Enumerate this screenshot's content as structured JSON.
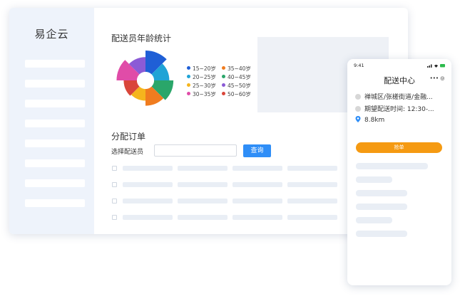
{
  "app": {
    "logo": "易企云"
  },
  "sidebar": {
    "item_count": 8
  },
  "age_chart": {
    "title": "配送员年龄统计",
    "legend": [
      {
        "label": "15~20岁",
        "color": "#1f5fd6"
      },
      {
        "label": "35~40岁",
        "color": "#f07c1f"
      },
      {
        "label": "20~25岁",
        "color": "#1fa3d6"
      },
      {
        "label": "40~45岁",
        "color": "#2aa66a"
      },
      {
        "label": "25~30岁",
        "color": "#f5b51d"
      },
      {
        "label": "45~50岁",
        "color": "#8b5bd6"
      },
      {
        "label": "30~35岁",
        "color": "#e04ca8"
      },
      {
        "label": "50~60岁",
        "color": "#d9463a"
      }
    ]
  },
  "chart_data": {
    "type": "pie",
    "variant": "nightingale-rose",
    "title": "配送员年龄统计",
    "categories": [
      "15~20岁",
      "20~25岁",
      "40~45岁",
      "35~40岁",
      "25~30岁",
      "50~60岁",
      "30~35岁",
      "45~50岁"
    ],
    "values": [
      42,
      30,
      38,
      33,
      23,
      26,
      40,
      29
    ],
    "colors": [
      "#1f5fd6",
      "#1fa3d6",
      "#2aa66a",
      "#f07c1f",
      "#f5b51d",
      "#d9463a",
      "#e04ca8",
      "#8b5bd6"
    ]
  },
  "orders": {
    "title": "分配订单",
    "field_label": "选择配送员",
    "field_value": "",
    "query_label": "查询",
    "row_count": 4,
    "col_count": 4
  },
  "phone": {
    "time": "9:41",
    "title": "配送中心",
    "capsule": "•••  ◎",
    "address": "禅城区/张槎街道/金融...",
    "expected_time": "期望配送时间: 12:30-...",
    "distance": "8.8km",
    "grab_label": "抢单"
  },
  "colors": {
    "accent": "#2f8ef7",
    "grab": "#f59a12",
    "sidebar_bg": "#eef3fb"
  }
}
